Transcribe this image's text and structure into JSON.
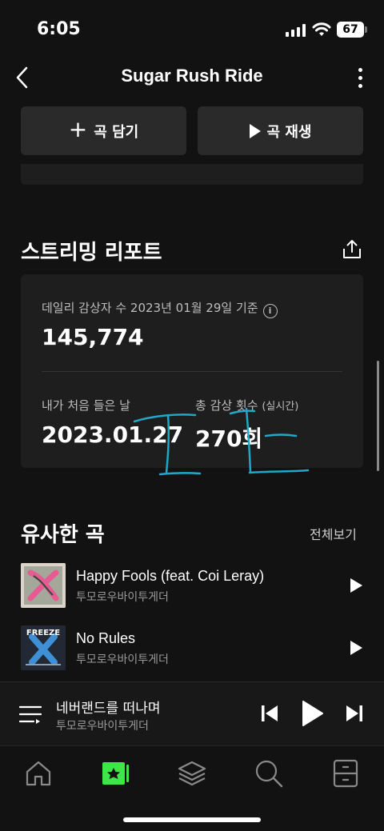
{
  "status": {
    "time": "6:05",
    "battery": "67"
  },
  "header": {
    "title": "Sugar Rush Ride"
  },
  "actions": {
    "add_label": "곡 담기",
    "play_label": "곡 재생"
  },
  "report": {
    "title": "스트리밍 리포트",
    "daily_label": "데일리 감상자 수 2023년 01월 29일 기준",
    "daily_value": "145,774",
    "first_listen_label": "내가 처음 들은 날",
    "first_listen_value": "2023.01.27",
    "total_label": "총 감상 횟수",
    "total_label_sub": "(실시간)",
    "total_value": "270회"
  },
  "similar": {
    "title": "유사한 곡",
    "view_all": "전체보기",
    "songs": [
      {
        "title": "Happy Fools (feat. Coi Leray)",
        "artist": "투모로우바이투게더"
      },
      {
        "title": "No Rules",
        "artist": "투모로우바이투게더",
        "art_text": "FREEZE"
      }
    ]
  },
  "now_playing": {
    "title": "네버랜드를 떠나며",
    "artist": "투모로우바이투게더"
  },
  "colors": {
    "accent": "#3ee64a",
    "background": "#121212",
    "card": "#1e1e1e",
    "handwriting": "#1fa9c8"
  },
  "tabs": [
    "home-icon",
    "my-music-icon",
    "library-icon",
    "search-icon",
    "storage-icon"
  ]
}
